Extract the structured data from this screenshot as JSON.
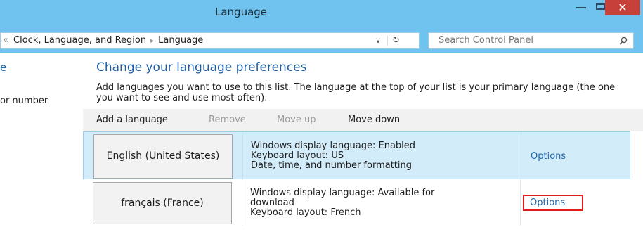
{
  "window": {
    "title": "Language",
    "minimize_glyph": "",
    "close_glyph": "✕"
  },
  "address": {
    "chevron": "«",
    "crumb_1": "Clock, Language, and Region",
    "separator": "▸",
    "crumb_2": "Language",
    "dropdown_glyph": "∨",
    "refresh_glyph": "↻"
  },
  "search": {
    "placeholder": "Search Control Panel",
    "icon": "search-icon"
  },
  "sidebar": {
    "partial_top": "e",
    "partial_number": "or number"
  },
  "main": {
    "title": "Change your language preferences",
    "description": "Add languages you want to use to this list. The language at the top of your list is your primary language (the one you want to see and use most often)."
  },
  "toolbar": {
    "add": "Add a language",
    "remove": "Remove",
    "move_up": "Move up",
    "move_down": "Move down"
  },
  "languages": [
    {
      "name": "English (United States)",
      "info": [
        "Windows display language: Enabled",
        "Keyboard layout: US",
        "Date, time, and number formatting"
      ],
      "options": "Options",
      "selected": true
    },
    {
      "name": "français (France)",
      "info": [
        "Windows display language: Available for",
        "download",
        "Keyboard layout: French"
      ],
      "options": "Options",
      "selected": false,
      "options_highlighted": true
    }
  ],
  "colors": {
    "titlebar": "#6fc3ee",
    "close_button": "#c7403a",
    "accent_link": "#2268ad",
    "selected_row": "#d3ecf9",
    "highlight": "#e01b1b"
  }
}
